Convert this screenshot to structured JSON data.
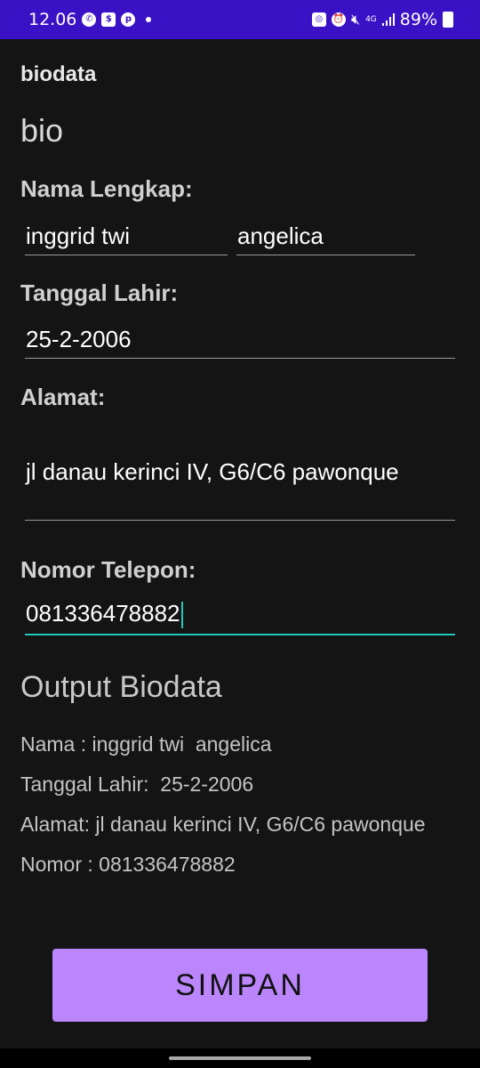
{
  "status_bar": {
    "time": "12.06",
    "network": "4G",
    "battery": "89%"
  },
  "app": {
    "title": "biodata",
    "heading": "bio"
  },
  "form": {
    "nama_label": "Nama Lengkap:",
    "first_name": "inggrid twi",
    "last_name": "angelica",
    "tanggal_label": "Tanggal Lahir:",
    "tanggal_value": "25-2-2006",
    "alamat_label": "Alamat:",
    "alamat_value": "jl danau kerinci IV, G6/C6 pawonque",
    "telepon_label": "Nomor Telepon:",
    "telepon_value": "081336478882"
  },
  "output": {
    "heading": "Output Biodata",
    "nama_line": "Nama : inggrid twi  angelica",
    "tanggal_line": "Tanggal Lahir:  25-2-2006",
    "alamat_line": "Alamat: jl danau kerinci IV, G6/C6 pawonque",
    "nomor_line": "Nomor : 081336478882"
  },
  "button": {
    "save_label": "SIMPAN"
  },
  "colors": {
    "status_bar": "#3a11c4",
    "background": "#141414",
    "button": "#bb86fc",
    "focus": "#1fc8b8"
  }
}
